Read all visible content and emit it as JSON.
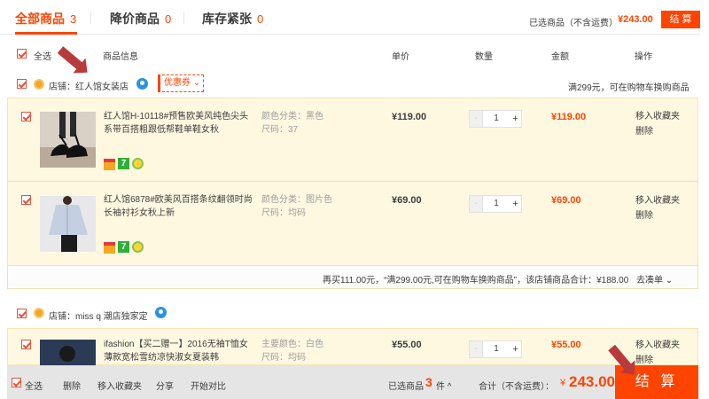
{
  "tabs": [
    {
      "label": "全部商品",
      "count": "3"
    },
    {
      "label": "降价商品",
      "count": "0"
    },
    {
      "label": "库存紧张",
      "count": "0"
    }
  ],
  "top_summary": {
    "label": "已选商品（不含运费）",
    "amount": "¥243.00",
    "button": "结 算"
  },
  "columns": {
    "select_all": "全选",
    "info": "商品信息",
    "unit_price": "单价",
    "qty": "数量",
    "amount": "金额",
    "ops": "操作"
  },
  "stores": [
    {
      "label": "店铺：红人馆女装店",
      "coupon": "优惠券 ⌄",
      "promo": "满299元，可在购物车换购商品",
      "items": [
        {
          "title": "红人馆H-10118#预售欧美风纯色尖头系带百搭粗跟低帮鞋单鞋女秋",
          "prop1": "颜色分类：黑色",
          "prop2": "尺码：37",
          "price": "¥119.00",
          "qty": "1",
          "sum": "¥119.00",
          "op1": "移入收藏夹",
          "op2": "删除"
        },
        {
          "title": "红人馆6878#欧美风百搭条纹翻领时尚长袖衬衫女秋上新",
          "prop1": "颜色分类：图片色",
          "prop2": "尺码：均码",
          "price": "¥69.00",
          "qty": "1",
          "sum": "¥69.00",
          "op1": "移入收藏夹",
          "op2": "删除"
        }
      ],
      "summary": "再买111.00元，“满299.00元,可在购物车换购商品”，该店铺商品合计：¥188.00",
      "summary_link": "去凑单 ⌄"
    },
    {
      "label": "店铺：miss q 潮店独家定",
      "items": [
        {
          "title": "ifashion【买二赠一】2016无袖T恤女薄款宽松雪纺凉快淑女夏装韩",
          "prop1": "主要颜色：白色",
          "prop2": "尺码：均码",
          "price": "¥55.00",
          "qty": "1",
          "sum": "¥55.00",
          "op1": "移入收藏夹",
          "op2": "删除"
        }
      ]
    }
  ],
  "bottom": {
    "select_all": "全选",
    "delete": "删除",
    "favorite": "移入收藏夹",
    "share": "分享",
    "compare": "开始对比",
    "selected_label": "已选商品",
    "selected_count": "3",
    "selected_unit": "件 ^",
    "total_label": "合计（不含运费）：",
    "currency": "¥",
    "total": "243.00",
    "settle": "结 算"
  },
  "stepper": {
    "minus": "-",
    "plus": "+"
  },
  "icons": {
    "store": "store-badge-icon",
    "wangwang": "wangwang-chat-icon",
    "card": "credit-card-icon",
    "seven": "seven-day-return-icon",
    "hand": "hand-badge-icon"
  },
  "colors": {
    "accent": "#ff4400",
    "row_bg": "#fff8e1",
    "arrow": "#b83a3a"
  }
}
